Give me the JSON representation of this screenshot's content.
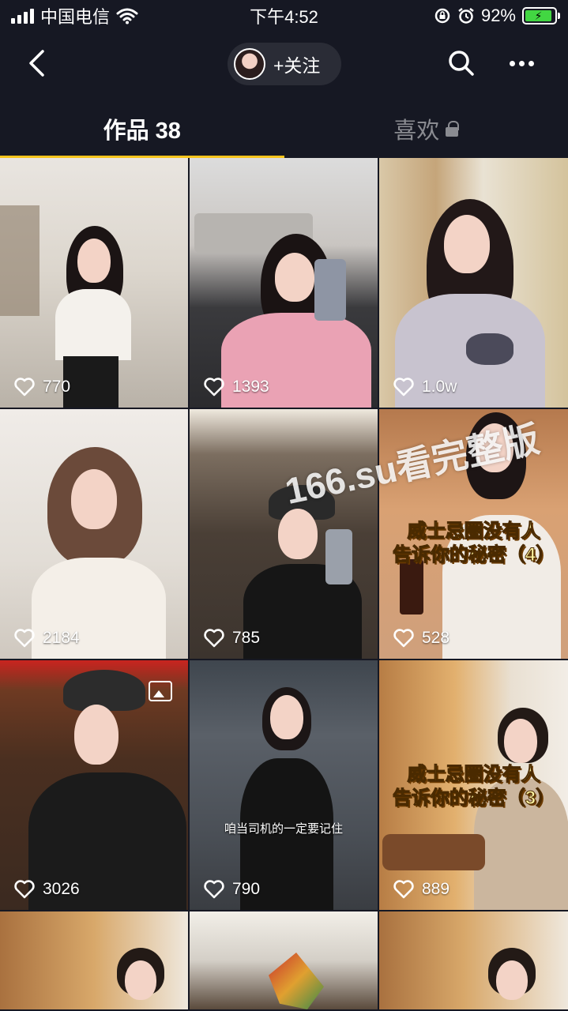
{
  "status_bar": {
    "carrier": "中国电信",
    "time": "下午4:52",
    "battery": "92%"
  },
  "nav": {
    "follow_label": "+关注"
  },
  "tabs": [
    {
      "label": "作品 38"
    },
    {
      "label": "喜欢"
    }
  ],
  "videos": [
    {
      "likes": "770"
    },
    {
      "likes": "1393"
    },
    {
      "likes": "1.0w"
    },
    {
      "likes": "2184"
    },
    {
      "likes": "785"
    },
    {
      "likes": "528",
      "title_line1": "威士忌圈没有人",
      "title_line2": "告诉你的秘密（4）"
    },
    {
      "likes": "3026"
    },
    {
      "likes": "790",
      "caption": "咱当司机的一定要记住"
    },
    {
      "likes": "889",
      "title_line1": "威士忌圈没有人",
      "title_line2": "告诉你的秘密（3）"
    },
    {
      "likes": ""
    },
    {
      "likes": ""
    },
    {
      "likes": ""
    }
  ],
  "watermark": "166.su看完整版",
  "colors": {
    "background": "#161823",
    "tab_indicator": "#f8c41c",
    "battery_fill": "#42d742"
  }
}
